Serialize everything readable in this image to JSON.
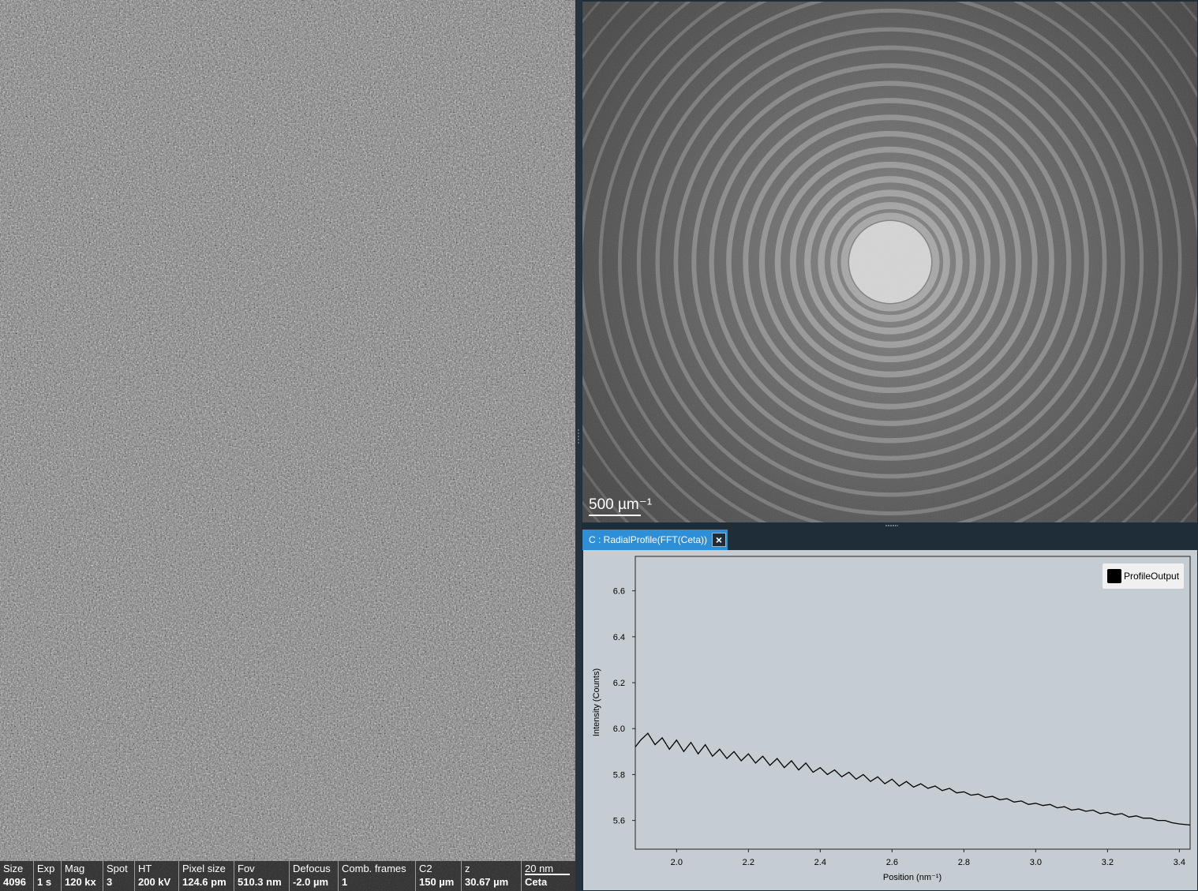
{
  "image_panel": {
    "status_items": [
      {
        "label": "Size",
        "value": "4096"
      },
      {
        "label": "Exp",
        "value": "1 s"
      },
      {
        "label": "Mag",
        "value": "120 kx"
      },
      {
        "label": "Spot",
        "value": "3"
      },
      {
        "label": "HT",
        "value": "200 kV"
      },
      {
        "label": "Pixel size",
        "value": "124.6 pm"
      },
      {
        "label": "Fov",
        "value": "510.3 nm"
      },
      {
        "label": "Defocus",
        "value": "-2.0 µm"
      },
      {
        "label": "Comb. frames",
        "value": "1"
      },
      {
        "label": "C2",
        "value": "150 µm"
      },
      {
        "label": "z",
        "value": "30.67 µm"
      }
    ],
    "scalebar": {
      "label": "20 nm",
      "detector": "Ceta"
    }
  },
  "fft_panel": {
    "scalebar_label": "500 µm⁻¹"
  },
  "profile_panel": {
    "tab_title": "C : RadialProfile(FFT(Ceta))",
    "close_icon": "×",
    "legend_label": "ProfileOutput",
    "legend_color": "#000000",
    "background_color": "#c5ccd2",
    "accent_color": "#2e8fd6"
  },
  "chart_data": {
    "type": "line",
    "xlabel": "Position (nm⁻¹)",
    "ylabel": "Intensity (Counts)",
    "xlim": [
      1.885,
      3.43
    ],
    "ylim": [
      5.475,
      6.75
    ],
    "xticks": [
      "2.0",
      "2.2",
      "2.4",
      "2.6",
      "2.8",
      "3.0",
      "3.2",
      "3.4"
    ],
    "yticks": [
      "5.6",
      "5.8",
      "6.0",
      "6.2",
      "6.4",
      "6.6"
    ],
    "xtick_values": [
      2.0,
      2.2,
      2.4,
      2.6,
      2.8,
      3.0,
      3.2,
      3.4
    ],
    "ytick_values": [
      5.6,
      5.8,
      6.0,
      6.2,
      6.4,
      6.6
    ],
    "series": [
      {
        "name": "ProfileOutput",
        "x": [
          1.885,
          1.9,
          1.92,
          1.94,
          1.96,
          1.98,
          2.0,
          2.02,
          2.04,
          2.06,
          2.08,
          2.1,
          2.12,
          2.14,
          2.16,
          2.18,
          2.2,
          2.22,
          2.24,
          2.26,
          2.28,
          2.3,
          2.32,
          2.34,
          2.36,
          2.38,
          2.4,
          2.42,
          2.44,
          2.46,
          2.48,
          2.5,
          2.52,
          2.54,
          2.56,
          2.58,
          2.6,
          2.62,
          2.64,
          2.66,
          2.68,
          2.7,
          2.72,
          2.74,
          2.76,
          2.78,
          2.8,
          2.82,
          2.84,
          2.86,
          2.88,
          2.9,
          2.92,
          2.94,
          2.96,
          2.98,
          3.0,
          3.02,
          3.04,
          3.06,
          3.08,
          3.1,
          3.12,
          3.14,
          3.16,
          3.18,
          3.2,
          3.22,
          3.24,
          3.26,
          3.28,
          3.3,
          3.32,
          3.34,
          3.36,
          3.38,
          3.4,
          3.43
        ],
        "values": [
          5.92,
          5.95,
          5.98,
          5.93,
          5.96,
          5.91,
          5.95,
          5.9,
          5.94,
          5.89,
          5.93,
          5.88,
          5.91,
          5.87,
          5.9,
          5.86,
          5.89,
          5.85,
          5.88,
          5.84,
          5.87,
          5.83,
          5.86,
          5.82,
          5.85,
          5.81,
          5.83,
          5.8,
          5.82,
          5.79,
          5.81,
          5.78,
          5.8,
          5.77,
          5.79,
          5.76,
          5.78,
          5.75,
          5.77,
          5.745,
          5.76,
          5.74,
          5.75,
          5.73,
          5.74,
          5.72,
          5.725,
          5.71,
          5.715,
          5.7,
          5.705,
          5.69,
          5.695,
          5.68,
          5.685,
          5.67,
          5.675,
          5.665,
          5.67,
          5.655,
          5.66,
          5.645,
          5.65,
          5.64,
          5.645,
          5.63,
          5.635,
          5.625,
          5.63,
          5.615,
          5.62,
          5.61,
          5.61,
          5.6,
          5.6,
          5.59,
          5.585,
          5.58
        ]
      }
    ]
  }
}
